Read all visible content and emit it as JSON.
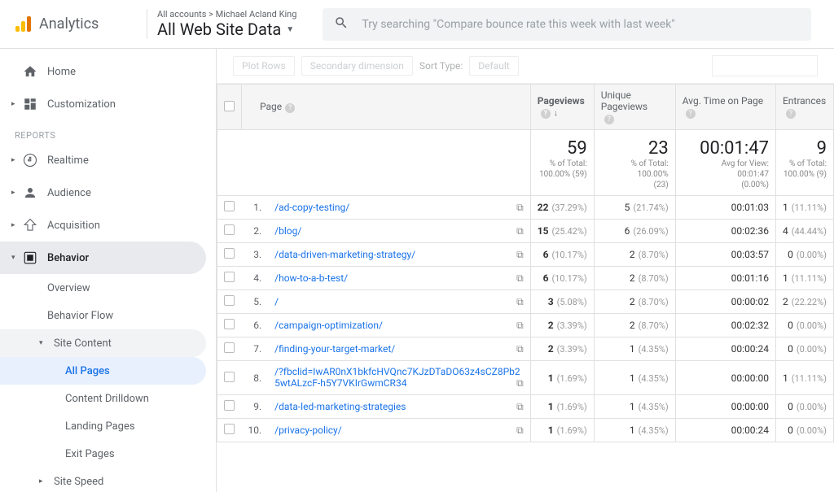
{
  "header": {
    "logo_text": "Analytics",
    "breadcrumb": "All accounts > Michael Acland King",
    "view_title": "All Web Site Data",
    "search_placeholder": "Try searching \"Compare bounce rate this week with last week\""
  },
  "sidebar": {
    "home": "Home",
    "customization": "Customization",
    "reports_label": "REPORTS",
    "realtime": "Realtime",
    "audience": "Audience",
    "acquisition": "Acquisition",
    "behavior": "Behavior",
    "overview": "Overview",
    "behavior_flow": "Behavior Flow",
    "site_content": "Site Content",
    "all_pages": "All Pages",
    "content_drilldown": "Content Drilldown",
    "landing_pages": "Landing Pages",
    "exit_pages": "Exit Pages",
    "site_speed": "Site Speed"
  },
  "controls": {
    "plot_rows": "Plot Rows",
    "secondary_dimension": "Secondary dimension",
    "sort_type": "Sort Type:",
    "default": "Default"
  },
  "columns": {
    "page": "Page",
    "pageviews": "Pageviews",
    "unique_pageviews": "Unique Pageviews",
    "avg_time": "Avg. Time on Page",
    "entrances": "Entrances"
  },
  "summary": {
    "pageviews": {
      "big": "59",
      "sub1": "% of Total:",
      "sub2": "100.00% (59)"
    },
    "unique": {
      "big": "23",
      "sub1": "% of Total:",
      "sub2": "100.00%",
      "sub3": "(23)"
    },
    "avg_time": {
      "big": "00:01:47",
      "sub1": "Avg for View:",
      "sub2": "00:01:47",
      "sub3": "(0.00%)"
    },
    "entrances": {
      "big": "9",
      "sub1": "% of Total:",
      "sub2": "100.00% (9)"
    }
  },
  "rows": [
    {
      "n": "1.",
      "page": "/ad-copy-testing/",
      "pv": "22",
      "pvp": "(37.29%)",
      "up": "5",
      "upp": "(21.74%)",
      "t": "00:01:03",
      "e": "1",
      "ep": "(11.11%)"
    },
    {
      "n": "2.",
      "page": "/blog/",
      "pv": "15",
      "pvp": "(25.42%)",
      "up": "6",
      "upp": "(26.09%)",
      "t": "00:02:36",
      "e": "4",
      "ep": "(44.44%)"
    },
    {
      "n": "3.",
      "page": "/data-driven-marketing-strategy/",
      "pv": "6",
      "pvp": "(10.17%)",
      "up": "2",
      "upp": "(8.70%)",
      "t": "00:03:57",
      "e": "0",
      "ep": "(0.00%)"
    },
    {
      "n": "4.",
      "page": "/how-to-a-b-test/",
      "pv": "6",
      "pvp": "(10.17%)",
      "up": "2",
      "upp": "(8.70%)",
      "t": "00:01:16",
      "e": "1",
      "ep": "(11.11%)"
    },
    {
      "n": "5.",
      "page": "/",
      "pv": "3",
      "pvp": "(5.08%)",
      "up": "2",
      "upp": "(8.70%)",
      "t": "00:00:02",
      "e": "2",
      "ep": "(22.22%)"
    },
    {
      "n": "6.",
      "page": "/campaign-optimization/",
      "pv": "2",
      "pvp": "(3.39%)",
      "up": "2",
      "upp": "(8.70%)",
      "t": "00:02:32",
      "e": "0",
      "ep": "(0.00%)"
    },
    {
      "n": "7.",
      "page": "/finding-your-target-market/",
      "pv": "2",
      "pvp": "(3.39%)",
      "up": "1",
      "upp": "(4.35%)",
      "t": "00:00:24",
      "e": "0",
      "ep": "(0.00%)"
    },
    {
      "n": "8.",
      "page": "/?fbclid=IwAR0nX1bkfcHVQnc7KJzDTaDO63z4sCZ8Pb25wtALzcF-h5Y7VKIrGwmCR34",
      "pv": "1",
      "pvp": "(1.69%)",
      "up": "1",
      "upp": "(4.35%)",
      "t": "00:00:00",
      "e": "1",
      "ep": "(11.11%)"
    },
    {
      "n": "9.",
      "page": "/data-led-marketing-strategies",
      "pv": "1",
      "pvp": "(1.69%)",
      "up": "1",
      "upp": "(4.35%)",
      "t": "00:00:00",
      "e": "0",
      "ep": "(0.00%)"
    },
    {
      "n": "10.",
      "page": "/privacy-policy/",
      "pv": "1",
      "pvp": "(1.69%)",
      "up": "1",
      "upp": "(4.35%)",
      "t": "00:00:24",
      "e": "0",
      "ep": "(0.00%)"
    }
  ]
}
